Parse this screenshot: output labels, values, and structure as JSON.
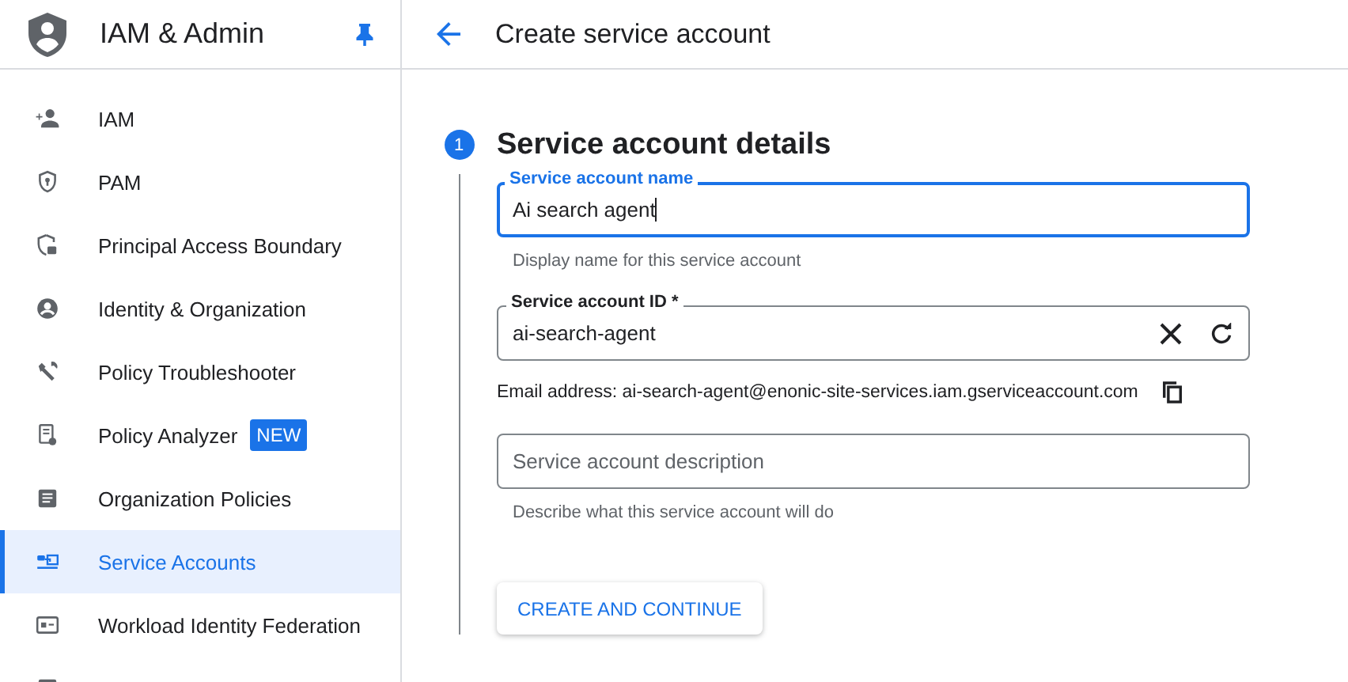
{
  "sidebar": {
    "title": "IAM & Admin",
    "items": [
      {
        "label": "IAM",
        "selected": false
      },
      {
        "label": "PAM",
        "selected": false
      },
      {
        "label": "Principal Access Boundary",
        "selected": false
      },
      {
        "label": "Identity & Organization",
        "selected": false
      },
      {
        "label": "Policy Troubleshooter",
        "selected": false
      },
      {
        "label": "Policy Analyzer",
        "selected": false,
        "badge": "NEW"
      },
      {
        "label": "Organization Policies",
        "selected": false
      },
      {
        "label": "Service Accounts",
        "selected": true
      },
      {
        "label": "Workload Identity Federation",
        "selected": false
      }
    ]
  },
  "page": {
    "title": "Create service account"
  },
  "step": {
    "number": "1",
    "title": "Service account details"
  },
  "fields": [
    {
      "label": "Service account name",
      "value": "Ai search agent",
      "focused": true,
      "hint": "Display name for this service account"
    },
    {
      "label": "Service account ID *",
      "value": "ai-search-agent",
      "focused": false
    }
  ],
  "email": "Email address: ai-search-agent@enonic-site-services.iam.gserviceaccount.com",
  "description": {
    "placeholder": "Service account description",
    "hint": "Describe what this service account will do"
  },
  "button": "CREATE AND CONTINUE"
}
